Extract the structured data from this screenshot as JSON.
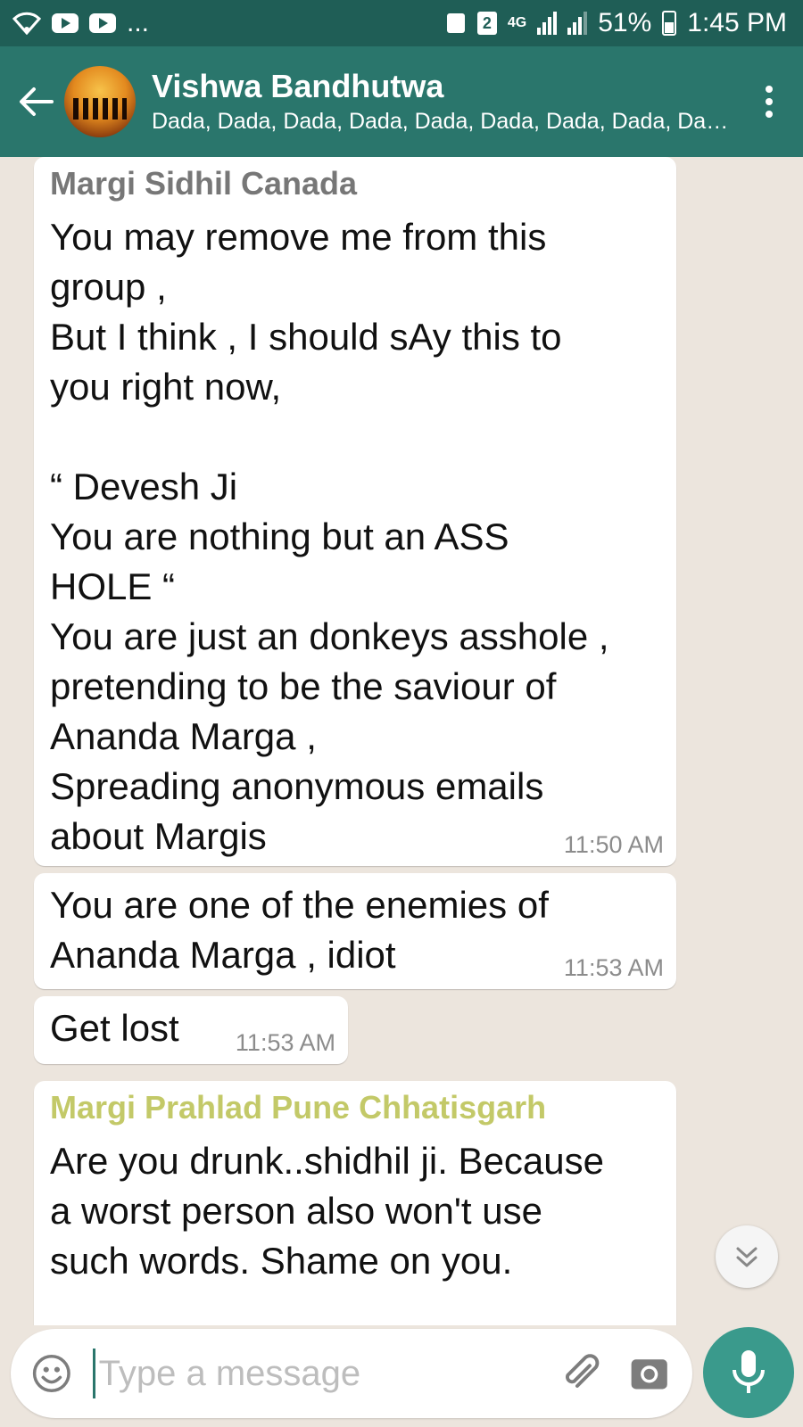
{
  "status_bar": {
    "left_more": "...",
    "sim_badge": "2",
    "network": "4G",
    "battery": "51%",
    "time": "1:45 PM"
  },
  "header": {
    "title": "Vishwa Bandhutwa",
    "subtitle": "Dada, Dada, Dada, Dada, Dada, Dada, Dada, Dada, Dada, Dada"
  },
  "messages": [
    {
      "sender": "Margi Sidhil Canada",
      "sender_color": "#777777",
      "text": "You may remove me from this\ngroup ,\nBut I think , I should sAy this to\nyou right now,\n\n“ Devesh Ji\nYou are nothing but an ASS\nHOLE “\nYou are just an donkeys asshole ,\npretending to be the saviour of\nAnanda Marga ,\nSpreading anonymous emails\nabout Margis",
      "time": "11:50 AM"
    },
    {
      "text": "You are one of the enemies of\nAnanda Marga , idiot",
      "time": "11:53 AM"
    },
    {
      "text": "Get lost",
      "time": "11:53 AM"
    },
    {
      "sender": "Margi Prahlad Pune Chhatisgarh",
      "sender_color": "#c3c968",
      "text": "Are you drunk..shidhil ji. Because\na worst person also won't use\nsuch words. Shame on you."
    }
  ],
  "input": {
    "placeholder": "Type a message"
  },
  "colors": {
    "header": "#2a766c",
    "status_bar": "#1f5e56",
    "background": "#ece5dd",
    "mic_button": "#3a9a8c"
  },
  "icons": [
    "wifi-icon",
    "youtube-icon",
    "back-arrow-icon",
    "menu-dots-icon",
    "emoji-icon",
    "attach-icon",
    "camera-icon",
    "mic-icon",
    "chevron-double-down-icon"
  ]
}
